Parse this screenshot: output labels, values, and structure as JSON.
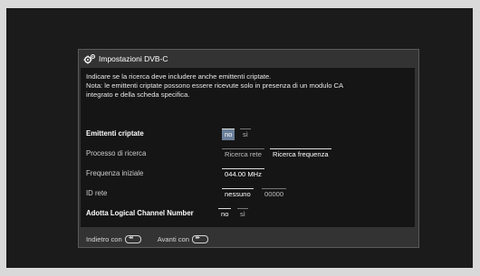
{
  "dialog": {
    "title": "Impostazioni DVB-C",
    "title_icon": "gears-icon",
    "description_line1": "Indicare se la ricerca deve includere anche emittenti criptate.",
    "description_line2": "Nota: le emittenti criptate possono essere ricevute solo in presenza di un modulo CA",
    "description_line3": "integrato e della scheda specifica."
  },
  "settings": {
    "encrypted": {
      "label": "Emittenti criptate",
      "no": "no",
      "si": "sì"
    },
    "search_process": {
      "label": "Processo di ricerca",
      "opt1": "Ricerca rete",
      "opt2": "Ricerca frequenza"
    },
    "start_frequency": {
      "label": "Frequenza iniziale",
      "value": "044.00 MHz"
    },
    "network_id": {
      "label": "ID rete",
      "opt1": "nessuno",
      "opt2": "00000"
    },
    "lcn": {
      "label": "Adotta Logical Channel Number",
      "no": "no",
      "si": "sì"
    }
  },
  "footer": {
    "back_label": "Indietro con",
    "back_icon_glyph": "◂◂",
    "next_label": "Avanti con",
    "next_icon_glyph": "▸▸"
  },
  "colors": {
    "focus_highlight": "#6a7f99",
    "dialog_bg": "#333333",
    "content_bg": "#151515"
  }
}
